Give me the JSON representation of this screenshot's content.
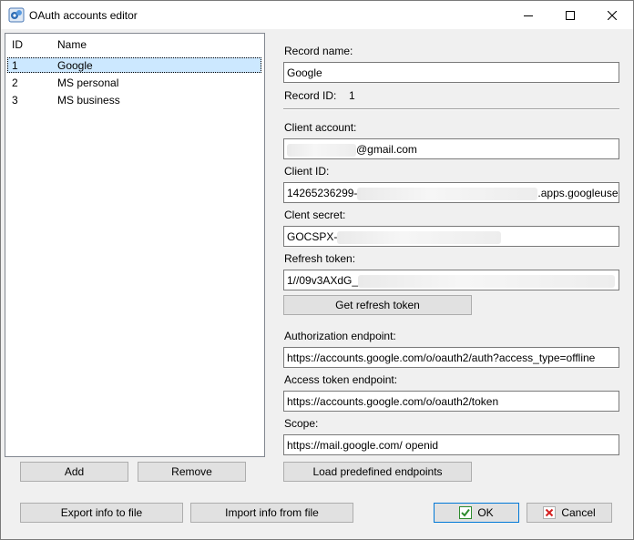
{
  "window": {
    "title": "OAuth accounts editor"
  },
  "list": {
    "columns": {
      "id": "ID",
      "name": "Name"
    },
    "rows": [
      {
        "id": "1",
        "name": "Google"
      },
      {
        "id": "2",
        "name": "MS personal"
      },
      {
        "id": "3",
        "name": "MS business"
      }
    ],
    "add_label": "Add",
    "remove_label": "Remove"
  },
  "form": {
    "record_name_label": "Record name:",
    "record_name_value": "Google",
    "record_id_label": "Record ID:",
    "record_id_value": "1",
    "client_account_label": "Client account:",
    "client_account_value": "@gmail.com",
    "client_id_label": "Client ID:",
    "client_id_prefix": "14265236299-",
    "client_id_suffix": ".apps.googleuser",
    "client_secret_label": "Clent secret:",
    "client_secret_value": "GOCSPX-",
    "refresh_token_label": "Refresh token:",
    "refresh_token_value": "1//09v3AXdG_",
    "get_refresh_token_label": "Get refresh token",
    "auth_endpoint_label": "Authorization endpoint:",
    "auth_endpoint_value": "https://accounts.google.com/o/oauth2/auth?access_type=offline",
    "token_endpoint_label": "Access token endpoint:",
    "token_endpoint_value": "https://accounts.google.com/o/oauth2/token",
    "scope_label": "Scope:",
    "scope_value": "https://mail.google.com/ openid",
    "load_predefined_label": "Load predefined endpoints"
  },
  "footer": {
    "export_label": "Export info to file",
    "import_label": "Import info from file",
    "ok_label": "OK",
    "cancel_label": "Cancel"
  },
  "colors": {
    "selection": "#cce8ff",
    "focus_border": "#0078d7",
    "ok_check": "#2e8b2e",
    "cancel_x": "#d42020"
  }
}
